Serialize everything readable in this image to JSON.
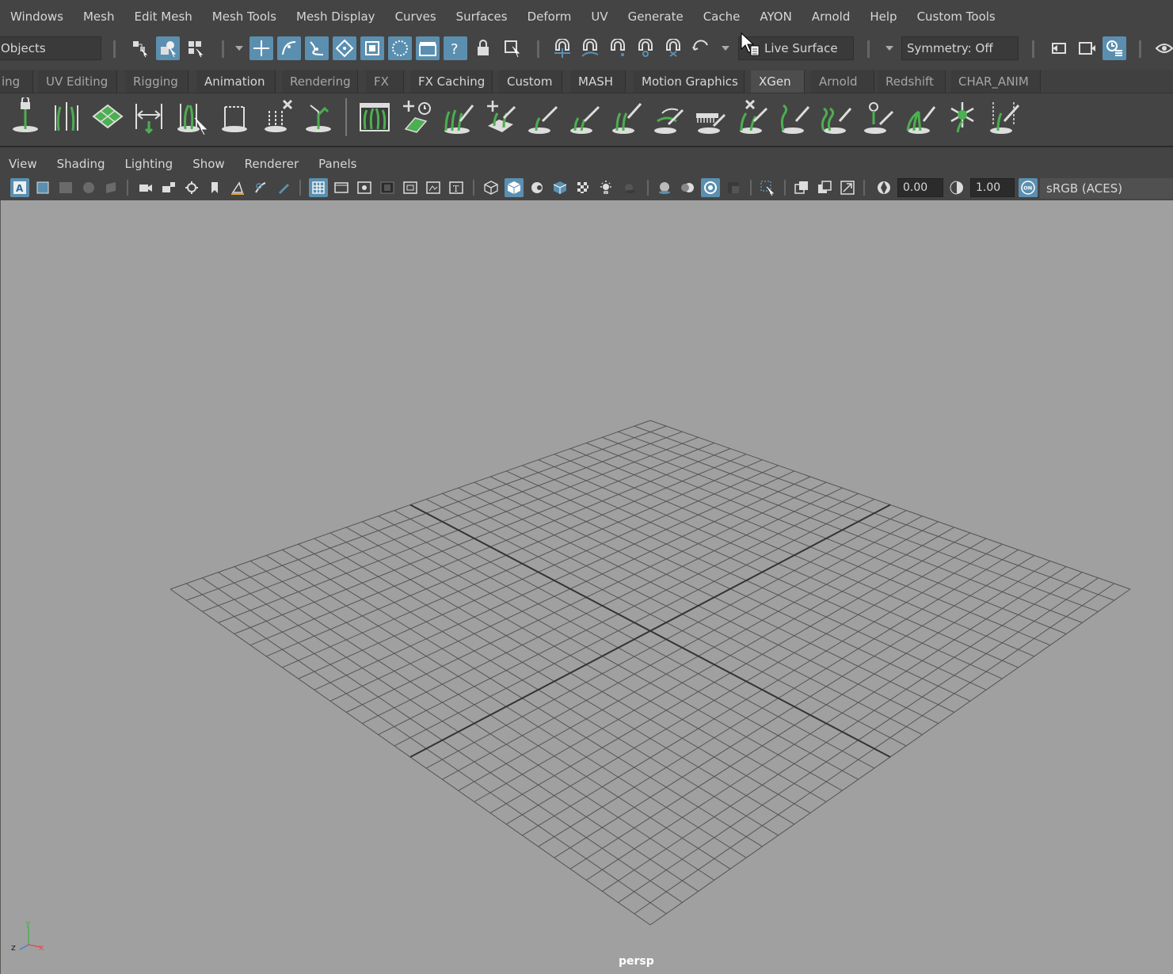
{
  "menubar": {
    "items": [
      "Windows",
      "Mesh",
      "Edit Mesh",
      "Mesh Tools",
      "Mesh Display",
      "Curves",
      "Surfaces",
      "Deform",
      "UV",
      "Generate",
      "Cache",
      "AYON",
      "Arnold",
      "Help",
      "Custom Tools"
    ]
  },
  "statusline": {
    "mode_dropdown": "Objects",
    "live_surface": "Live Surface",
    "symmetry": "Symmetry: Off"
  },
  "shelf_tabs": [
    {
      "label": "ing"
    },
    {
      "label": "UV Editing"
    },
    {
      "label": "Rigging"
    },
    {
      "label": "Animation"
    },
    {
      "label": "Rendering"
    },
    {
      "label": "FX"
    },
    {
      "label": "FX Caching"
    },
    {
      "label": "Custom"
    },
    {
      "label": "MASH"
    },
    {
      "label": "Motion Graphics"
    },
    {
      "label": "XGen"
    },
    {
      "label": "Arnold"
    },
    {
      "label": "Redshift"
    },
    {
      "label": "CHAR_ANIM"
    }
  ],
  "active_shelf_tab": "XGen",
  "panel_menu": {
    "items": [
      "View",
      "Shading",
      "Lighting",
      "Show",
      "Renderer",
      "Panels"
    ]
  },
  "panel_toolbar": {
    "exposure": "0.00",
    "gamma": "1.00",
    "color_space": "sRGB (ACES)",
    "color_mgmt_badge": "ON"
  },
  "viewport": {
    "camera_label": "persp",
    "axis_x": "x",
    "axis_y": "y",
    "axis_z": "z"
  },
  "colors": {
    "accent": "#5b8fb0",
    "viewport_bg": "#a0a0a0",
    "ui_bg": "#444444",
    "xgen_green": "#4caf50"
  }
}
